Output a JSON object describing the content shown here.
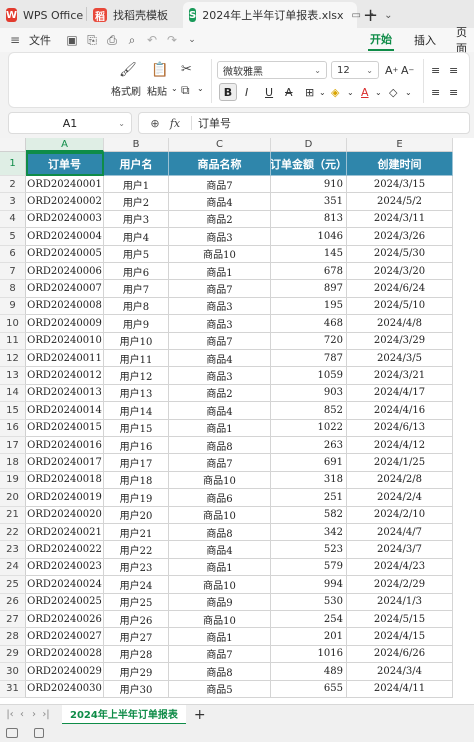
{
  "tabs": [
    {
      "label": "WPS Office",
      "icon": "wps-logo-icon"
    },
    {
      "label": "找稻壳模板",
      "icon": "daoke-logo-icon"
    },
    {
      "label": "2024年上半年订单报表.xlsx",
      "icon": "spreadsheet-s-icon",
      "icon_letter": "S"
    }
  ],
  "menu": {
    "file": "文件",
    "start": "开始",
    "insert": "插入",
    "page": "页面"
  },
  "ribbon": {
    "format_painter": "格式刷",
    "paste": "粘贴",
    "font_name": "微软雅黑",
    "font_size": "12",
    "bold": "B"
  },
  "formula_bar": {
    "cell_ref": "A1",
    "fx": "fx",
    "content": "订单号"
  },
  "columns": [
    "A",
    "B",
    "C",
    "D",
    "E"
  ],
  "header_row": [
    "订单号",
    "用户名",
    "商品名称",
    "订单金额（元）",
    "创建时间"
  ],
  "rows": [
    [
      "ORD20240001",
      "用户1",
      "商品7",
      "910",
      "2024/3/15"
    ],
    [
      "ORD20240002",
      "用户2",
      "商品4",
      "351",
      "2024/5/2"
    ],
    [
      "ORD20240003",
      "用户3",
      "商品2",
      "813",
      "2024/3/11"
    ],
    [
      "ORD20240004",
      "用户4",
      "商品3",
      "1046",
      "2024/3/26"
    ],
    [
      "ORD20240005",
      "用户5",
      "商品10",
      "145",
      "2024/5/30"
    ],
    [
      "ORD20240006",
      "用户6",
      "商品1",
      "678",
      "2024/3/20"
    ],
    [
      "ORD20240007",
      "用户7",
      "商品7",
      "897",
      "2024/6/24"
    ],
    [
      "ORD20240008",
      "用户8",
      "商品3",
      "195",
      "2024/5/10"
    ],
    [
      "ORD20240009",
      "用户9",
      "商品3",
      "468",
      "2024/4/8"
    ],
    [
      "ORD20240010",
      "用户10",
      "商品7",
      "720",
      "2024/3/29"
    ],
    [
      "ORD20240011",
      "用户11",
      "商品4",
      "787",
      "2024/3/5"
    ],
    [
      "ORD20240012",
      "用户12",
      "商品3",
      "1059",
      "2024/3/21"
    ],
    [
      "ORD20240013",
      "用户13",
      "商品2",
      "903",
      "2024/4/17"
    ],
    [
      "ORD20240014",
      "用户14",
      "商品4",
      "852",
      "2024/4/16"
    ],
    [
      "ORD20240015",
      "用户15",
      "商品1",
      "1022",
      "2024/6/13"
    ],
    [
      "ORD20240016",
      "用户16",
      "商品8",
      "263",
      "2024/4/12"
    ],
    [
      "ORD20240017",
      "用户17",
      "商品7",
      "691",
      "2024/1/25"
    ],
    [
      "ORD20240018",
      "用户18",
      "商品10",
      "318",
      "2024/2/8"
    ],
    [
      "ORD20240019",
      "用户19",
      "商品6",
      "251",
      "2024/2/4"
    ],
    [
      "ORD20240020",
      "用户20",
      "商品10",
      "582",
      "2024/2/10"
    ],
    [
      "ORD20240021",
      "用户21",
      "商品8",
      "342",
      "2024/4/7"
    ],
    [
      "ORD20240022",
      "用户22",
      "商品4",
      "523",
      "2024/3/7"
    ],
    [
      "ORD20240023",
      "用户23",
      "商品1",
      "579",
      "2024/4/23"
    ],
    [
      "ORD20240024",
      "用户24",
      "商品10",
      "994",
      "2024/2/29"
    ],
    [
      "ORD20240025",
      "用户25",
      "商品9",
      "530",
      "2024/1/3"
    ],
    [
      "ORD20240026",
      "用户26",
      "商品10",
      "254",
      "2024/5/15"
    ],
    [
      "ORD20240027",
      "用户27",
      "商品1",
      "201",
      "2024/4/15"
    ],
    [
      "ORD20240028",
      "用户28",
      "商品7",
      "1016",
      "2024/6/26"
    ],
    [
      "ORD20240029",
      "用户29",
      "商品8",
      "489",
      "2024/3/4"
    ],
    [
      "ORD20240030",
      "用户30",
      "商品5",
      "655",
      "2024/4/11"
    ]
  ],
  "row_numbers": [
    "1",
    "2",
    "3",
    "4",
    "5",
    "6",
    "7",
    "8",
    "9",
    "10",
    "11",
    "12",
    "13",
    "14",
    "15",
    "16",
    "17",
    "18",
    "19",
    "20",
    "21",
    "22",
    "23",
    "24",
    "25",
    "26",
    "27",
    "28",
    "29",
    "30",
    "31"
  ],
  "sheet_tab": "2024年上半年订单报表",
  "colors": {
    "header_fill": "#2f86ab",
    "accent_green": "#0f8c48",
    "wps_red": "#e23b2e"
  }
}
